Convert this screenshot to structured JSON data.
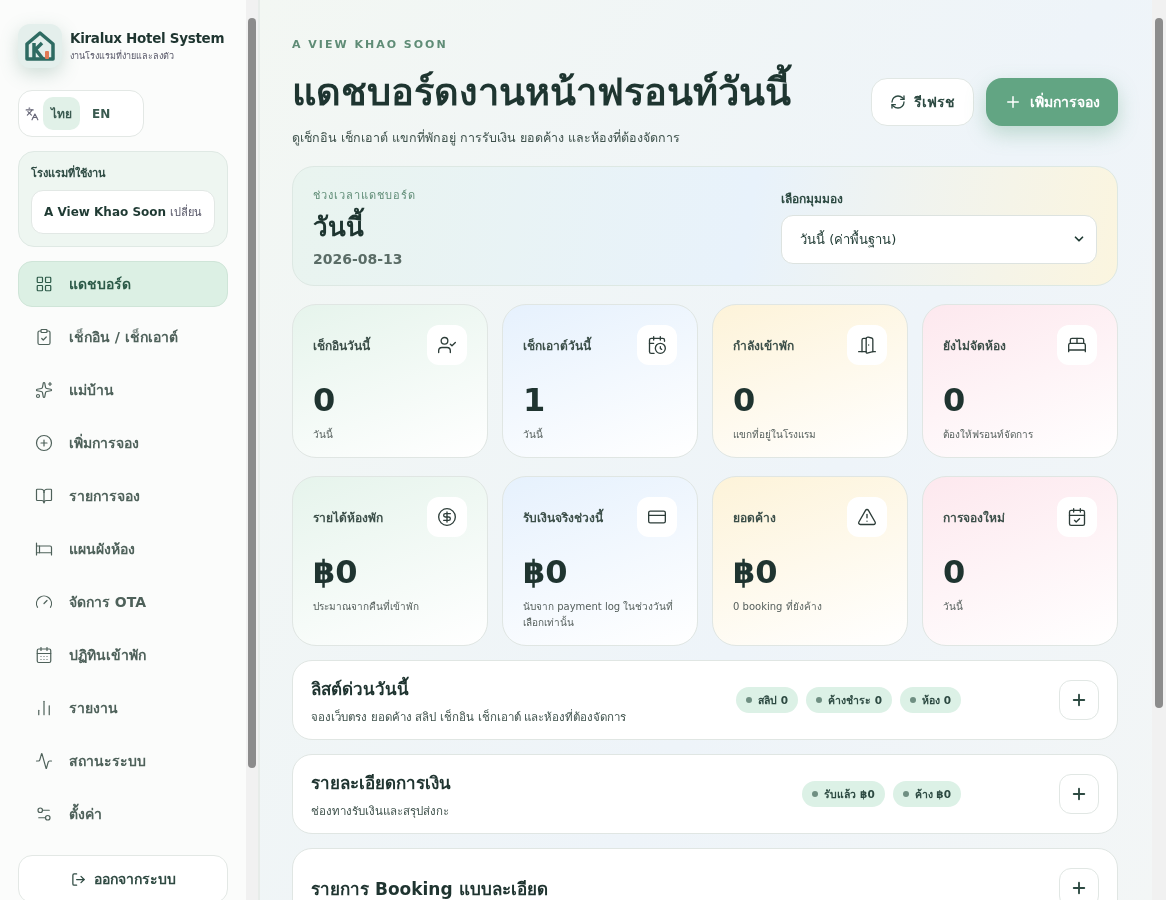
{
  "brand": {
    "name": "Kiralux Hotel System",
    "tagline": "งานโรงแรมที่ง่ายและลงตัว"
  },
  "language": [
    {
      "label": "ไทย",
      "selected": true
    },
    {
      "label": "EN",
      "selected": false
    }
  ],
  "hotel": {
    "label": "โรงแรมที่ใช้งาน",
    "name": "A View Khao Soon",
    "action": "เปลี่ยน"
  },
  "nav": [
    {
      "label": "แดชบอร์ด",
      "selected": true
    },
    {
      "label": "เช็กอิน / เช็กเอาต์",
      "selected": false
    },
    {
      "label": "แม่บ้าน",
      "selected": false
    },
    {
      "label": "เพิ่มการจอง",
      "selected": false
    },
    {
      "label": "รายการจอง",
      "selected": false
    },
    {
      "label": "แผนผังห้อง",
      "selected": false
    },
    {
      "label": "จัดการ OTA",
      "selected": false
    },
    {
      "label": "ปฏิทินเข้าพัก",
      "selected": false
    },
    {
      "label": "รายงาน",
      "selected": false
    },
    {
      "label": "สถานะระบบ",
      "selected": false
    },
    {
      "label": "ตั้งค่า",
      "selected": false
    }
  ],
  "logout": "ออกจากระบบ",
  "header": {
    "eyebrow": "A VIEW KHAO SOON",
    "title": "แดชบอร์ดงานหน้าฟรอนท์วันนี้",
    "subtitle": "ดูเช็กอิน เช็กเอาต์ แขกที่พักอยู่ การรับเงิน ยอดค้าง และห้องที่ต้องจัดการ",
    "refresh": "รีเฟรช",
    "add_booking": "เพิ่มการจอง"
  },
  "period": {
    "label": "ช่วงเวลาแดชบอร์ด",
    "value": "วันนี้",
    "date": "2026-08-13",
    "view_label": "เลือกมุมมอง",
    "view_value": "วันนี้ (ค่าพื้นฐาน)"
  },
  "stats": [
    {
      "label": "เช็กอินวันนี้",
      "value": "0",
      "note": "วันนี้",
      "color": "#e6f4ec"
    },
    {
      "label": "เช็กเอาต์วันนี้",
      "value": "1",
      "note": "วันนี้",
      "color": "#e6f1fd"
    },
    {
      "label": "กำลังเข้าพัก",
      "value": "0",
      "note": "แขกที่อยู่ในโรงแรม",
      "color": "#fdf3d9"
    },
    {
      "label": "ยังไม่จัดห้อง",
      "value": "0",
      "note": "ต้องให้ฟรอนท์จัดการ",
      "color": "#fde8ee"
    },
    {
      "label": "รายได้ห้องพัก",
      "value": "฿0",
      "note": "ประมาณจากคืนที่เข้าพัก",
      "color": "#e6f4ec"
    },
    {
      "label": "รับเงินจริงช่วงนี้",
      "value": "฿0",
      "note": "นับจาก payment log ในช่วงวันที่เลือกเท่านั้น",
      "color": "#e6f1fd"
    },
    {
      "label": "ยอดค้าง",
      "value": "฿0",
      "note": "0 booking ที่ยังค้าง",
      "color": "#fdf3d9"
    },
    {
      "label": "การจองใหม่",
      "value": "0",
      "note": "วันนี้",
      "color": "#fde8ee"
    }
  ],
  "panels": [
    {
      "title": "ลิสต์ด่วนวันนี้",
      "subtitle": "จองเว็บตรง ยอดค้าง สลิป เช็กอิน เช็กเอาต์ และห้องที่ต้องจัดการ",
      "expanded": false,
      "pills": [
        {
          "label": "สลิป 0",
          "color": "#dcf1e6"
        },
        {
          "label": "ค้างชำระ 0",
          "color": "#dcf1e6"
        },
        {
          "label": "ห้อง 0",
          "color": "#dcf1e6"
        }
      ]
    },
    {
      "title": "รายละเอียดการเงิน",
      "subtitle": "ช่องทางรับเงินและสรุปส่งกะ",
      "expanded": false,
      "pills": [
        {
          "label": "รับแล้ว ฿0",
          "color": "#dcf1e6"
        },
        {
          "label": "ค้าง ฿0",
          "color": "#dcf1e6"
        }
      ]
    },
    {
      "title": "รายการ Booking แบบละเอียด",
      "expanded": false
    }
  ]
}
